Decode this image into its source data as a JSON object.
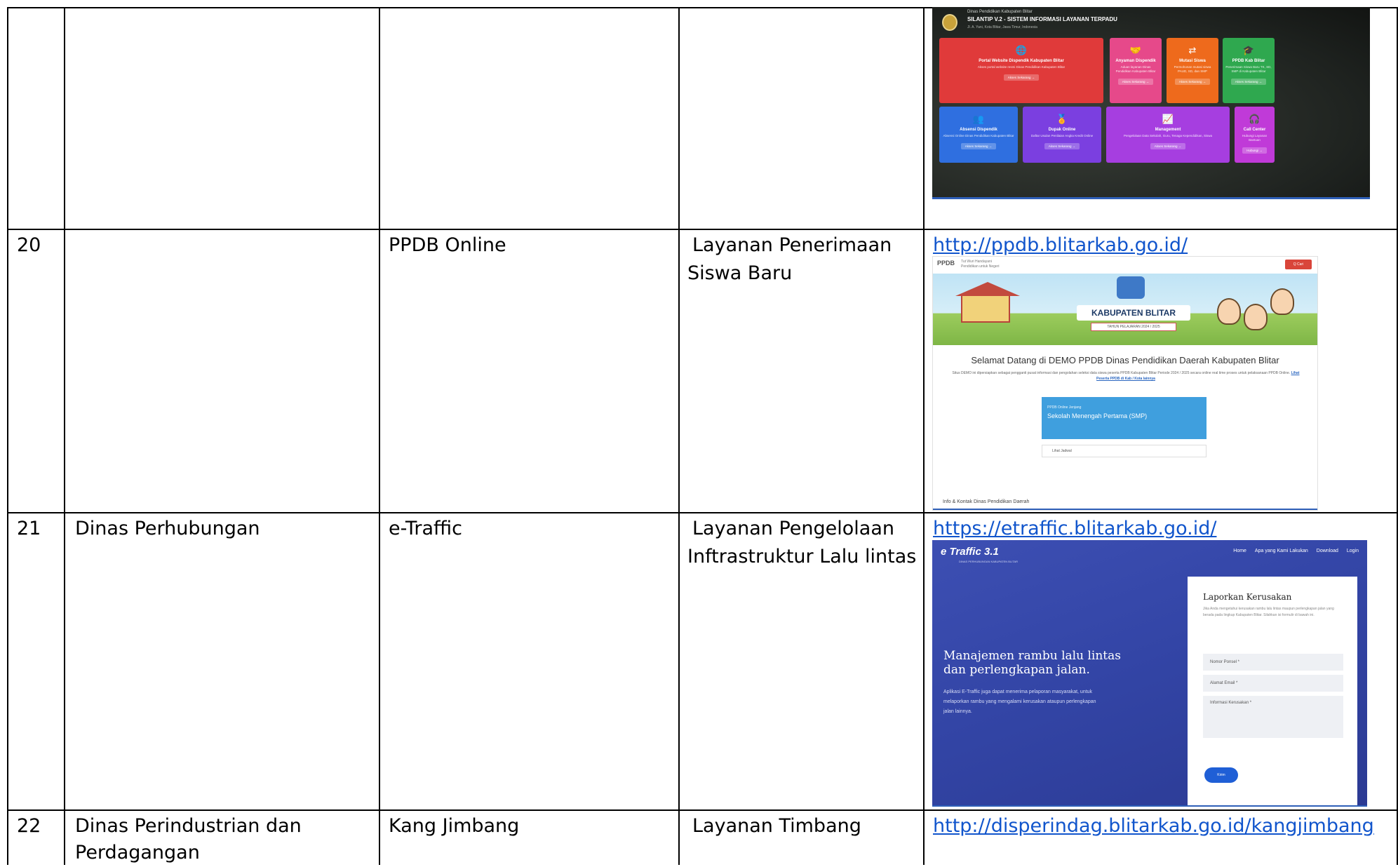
{
  "rows": [
    {
      "no": "",
      "dinas": "",
      "aplikasi": "",
      "layanan": ""
    },
    {
      "no": "20",
      "dinas": "",
      "aplikasi": "PPDB Online",
      "layanan_line1": "Layanan Penerimaan",
      "layanan_line2": "Siswa Baru",
      "link": "http://ppdb.blitarkab.go.id/"
    },
    {
      "no": "21",
      "dinas": "Dinas Perhubungan",
      "aplikasi": "e-Traffic",
      "layanan_line1": "Layanan Pengelolaan",
      "layanan_line2": "Inftrastruktur Lalu lintas",
      "link": "https://etraffic.blitarkab.go.id/"
    },
    {
      "no": "22",
      "dinas_line1": "Dinas Perindustrian dan",
      "dinas_line2": "Perdagangan",
      "aplikasi": "Kang Jimbang",
      "layanan_line1": "Layanan Timbang",
      "link": "http://disperindag.blitarkab.go.id/kangjimbang"
    }
  ],
  "silantip": {
    "org": "Dinas Pendidikan Kabupaten Blitar",
    "title": "SILANTIP V.2 - SISTEM INFORMASI LAYANAN TERPADU",
    "address": "Jl. A. Yani, Kota Blitar, Jawa Timur, Indonesia",
    "tiles": [
      {
        "label": "Portal Website Dispendik Kabupaten Blitar",
        "desc": "Akses portal website resmi Dinas Pendidikan Kabupaten Blitar",
        "btn": "Akses Sekarang →",
        "color": "#e03a3a",
        "icon": "🌐"
      },
      {
        "label": "Anyaman Dispendik",
        "desc": "Aduan layanan Dinas Pendidikan Kabupaten Blitar",
        "btn": "Akses Sekarang →",
        "color": "#e6498a",
        "icon": "🤝"
      },
      {
        "label": "Mutasi Siswa",
        "desc": "Permohonan mutasi siswa PAUD, SD, dan SMP",
        "btn": "Akses Sekarang →",
        "color": "#ee6a1c",
        "icon": "⇄"
      },
      {
        "label": "PPDB Kab Blitar",
        "desc": "Penerimaan Siswa Baru TK, SD, SMP di Kabupaten Blitar",
        "btn": "Akses Sekarang →",
        "color": "#2fa84f",
        "icon": "🎓"
      },
      {
        "label": "Absensi Dispendik",
        "desc": "Absensi Online Dinas Pendidikan Kabupaten Blitar",
        "btn": "Akses Sekarang →",
        "color": "#2f6fe0",
        "icon": "👥"
      },
      {
        "label": "Dupak Online",
        "desc": "Daftar Usulan Penilaian Angka Kredit Online",
        "btn": "Akses Sekarang →",
        "color": "#7b3fe0",
        "icon": "🏅"
      },
      {
        "label": "Management",
        "desc": "Pengelolaan Data Sekolah, Guru, Tenaga Kependidikan, Siswa",
        "btn": "Akses Sekarang →",
        "color": "#a63ee0",
        "icon": "📈"
      },
      {
        "label": "Call Center",
        "desc": "Hubungi Layanan Bantuan",
        "btn": "Hubungi →",
        "color": "#c03ad8",
        "icon": "🎧"
      }
    ]
  },
  "ppdb": {
    "hdr_logo": "PPDB",
    "hdr_sub1": "Tut Wuri Handayani",
    "hdr_sub2": "Pendidikan untuk Negeri",
    "hdr_btn": "Q Cari",
    "banner_title": "KABUPATEN BLITAR",
    "banner_sub": "TAHUN PELAJARAN 2024 / 2025",
    "welcome": "Selamat Datang di DEMO PPDB Dinas Pendidikan Daerah Kabupaten Blitar",
    "desc": "Situs DEMO ini dipersiapkan sebagai pengganti pusat informasi dan pengolahan seleksi data siswa peserta PPDB Kabupaten Blitar Periode 2024 / 2025 secara online real time proses untuk pelaksanaan PPDB Online.",
    "desc_link": "Lihat Peserta PPDB di Kab / Kota lainnya",
    "card_label": "PPDB Online Jenjang",
    "card_title": "Sekolah Menengah Pertama (SMP)",
    "jadwal": "Lihat Jadwal",
    "info": "Info & Kontak Dinas Pendidikan Daerah"
  },
  "etraffic": {
    "logo": "e Traffic 3.1",
    "logo_sub": "DINAS PERHUBUNGAN KABUPATEN BLITAR",
    "nav": [
      "Home",
      "Apa yang Kami Lakukan",
      "Download",
      "Login"
    ],
    "hero": "Manajemen rambu lalu lintas dan perlengkapan jalan.",
    "hero_desc": "Aplikasi E-Traffic juga dapat menerima pelaporan masyarakat, untuk melaporkan rambu yang mengalami kerusakan ataupun perlengkapan jalan lainnya.",
    "form_title": "Laporkan Kerusakan",
    "form_desc": "Jika Anda mengetahui kerusakan rambu lalu lintas maupun perlengkapan jalan yang berada pada lingkup Kabupaten Blitar. Silahkan isi formulir di bawah ini.",
    "field_phone": "Nomor Ponsel *",
    "field_email": "Alamat Email *",
    "field_info": "Informasi Kerusakan *",
    "submit": "Kirim"
  }
}
